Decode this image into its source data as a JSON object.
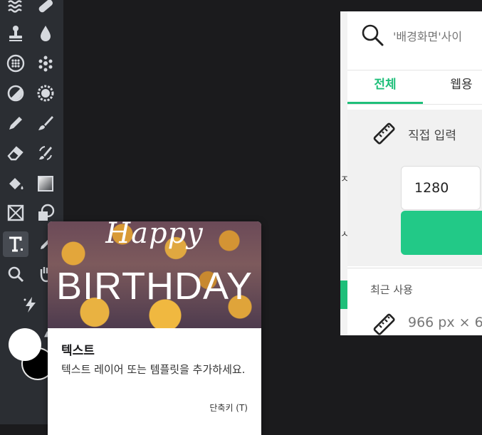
{
  "toolbar": {
    "tools": [
      {
        "name": "wave-filter-icon"
      },
      {
        "name": "bandage-icon"
      },
      {
        "name": "stamp-icon"
      },
      {
        "name": "drop-icon"
      },
      {
        "name": "mosaic-icon"
      },
      {
        "name": "scatter-dots-icon"
      },
      {
        "name": "contrast-icon"
      },
      {
        "name": "gear-sun-icon"
      },
      {
        "name": "pencil-icon"
      },
      {
        "name": "brush-icon"
      },
      {
        "name": "eraser-icon"
      },
      {
        "name": "replace-brush-icon"
      },
      {
        "name": "paint-bucket-icon"
      },
      {
        "name": "gradient-icon"
      },
      {
        "name": "frame-icon"
      },
      {
        "name": "shape-icon"
      },
      {
        "name": "text-tool-icon",
        "active": true
      },
      {
        "name": "pen-icon"
      },
      {
        "name": "zoom-icon"
      },
      {
        "name": "hand-icon"
      },
      {
        "name": "magic-bolt-icon"
      }
    ],
    "foreground_color": "#ffffff",
    "background_color": "#000000"
  },
  "tooltip": {
    "banner_line1": "Happy",
    "banner_line2": "BIRTHDAY",
    "title": "텍스트",
    "description": "텍스트 레이어 또는 템플릿을 추가하세요.",
    "shortcut": "단축키 (T)"
  },
  "panel": {
    "search_placeholder": "'배경화면'사이",
    "tabs": [
      {
        "label": "전체",
        "active": true
      },
      {
        "label": "웹용",
        "active": false
      }
    ],
    "custom_label": "직접 입력",
    "width_value": "1280",
    "recent_label": "최근 사용",
    "recent_size": "966 px × 6",
    "accent_color": "#1fbf7a"
  }
}
